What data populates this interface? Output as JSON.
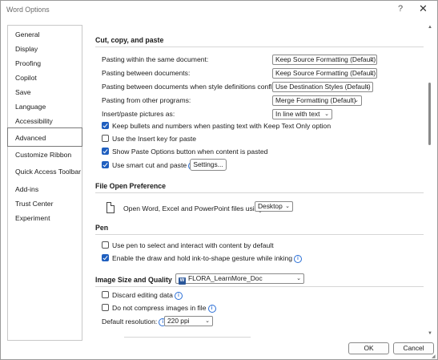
{
  "window": {
    "title": "Word Options",
    "help_glyph": "?",
    "close_glyph": "✕"
  },
  "nav": {
    "items": [
      {
        "label": "General"
      },
      {
        "label": "Display"
      },
      {
        "label": "Proofing"
      },
      {
        "label": "Copilot"
      },
      {
        "label": "Save"
      },
      {
        "label": "Language"
      },
      {
        "label": "Accessibility"
      },
      {
        "label": "Advanced",
        "selected": true
      },
      {
        "label": "Customize Ribbon"
      },
      {
        "label": "Quick Access Toolbar"
      },
      {
        "label": "Add-ins"
      },
      {
        "label": "Trust Center"
      },
      {
        "label": "Experiment"
      }
    ]
  },
  "cut_copy_paste": {
    "heading": "Cut, copy, and paste",
    "rows": [
      {
        "label": "Pasting within the same document:",
        "value": "Keep Source Formatting (Default)"
      },
      {
        "label": "Pasting between documents:",
        "value": "Keep Source Formatting (Default)"
      },
      {
        "label": "Pasting between documents when style definitions conflict:",
        "value": "Use Destination Styles (Default)"
      },
      {
        "label": "Pasting from other programs:",
        "value": "Merge Formatting (Default)"
      },
      {
        "label": "Insert/paste pictures as:",
        "value": "In line with text"
      }
    ],
    "checks": [
      {
        "label": "Keep bullets and numbers when pasting text with Keep Text Only option",
        "checked": true
      },
      {
        "label": "Use the Insert key for paste",
        "checked": false
      },
      {
        "label": "Show Paste Options button when content is pasted",
        "checked": true
      },
      {
        "label": "Use smart cut and paste",
        "checked": true
      }
    ],
    "settings_button": "Settings..."
  },
  "file_open": {
    "heading": "File Open Preference",
    "label": "Open Word, Excel and PowerPoint files using:",
    "value": "Desktop"
  },
  "pen": {
    "heading": "Pen",
    "checks": [
      {
        "label": "Use pen to select and interact with content by default",
        "checked": false
      },
      {
        "label": "Enable the draw and hold ink-to-shape gesture while inking",
        "checked": true
      }
    ]
  },
  "image": {
    "heading": "Image Size and Quality",
    "doc_value": "FLORA_LearnMore_Doc",
    "checks": [
      {
        "label": "Discard editing data",
        "checked": false
      },
      {
        "label": "Do not compress images in file",
        "checked": false
      }
    ],
    "resolution_label": "Default resolution:",
    "resolution_value": "220 ppi"
  },
  "footer": {
    "ok": "OK",
    "cancel": "Cancel"
  },
  "icons": {
    "info": "i",
    "chevron": "⌄",
    "word_letter": "W"
  },
  "colors": {
    "accent": "#1f5fbf",
    "info": "#2b6fd6"
  }
}
